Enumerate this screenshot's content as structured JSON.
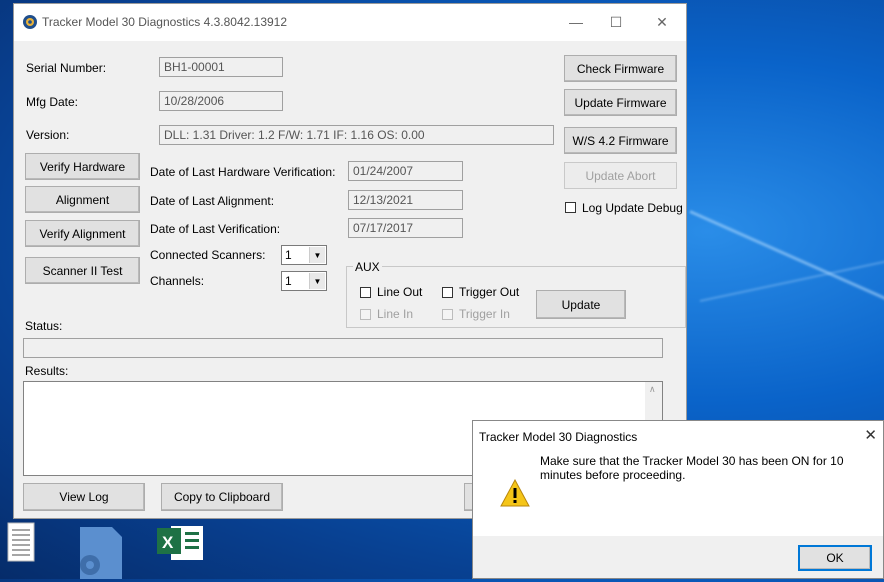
{
  "window": {
    "title": "Tracker Model 30 Diagnostics 4.3.8042.13912",
    "minimize": "—",
    "maximize": "☐",
    "close": "✕"
  },
  "info": {
    "serial_label": "Serial Number:",
    "serial_value": "BH1-00001",
    "mfg_label": "Mfg Date:",
    "mfg_value": "10/28/2006",
    "version_label": "Version:",
    "version_value": "DLL: 1.31  Driver: 1.2  F/W: 1.71 IF: 1.16  OS: 0.00"
  },
  "right_buttons": {
    "check_firmware": "Check Firmware",
    "update_firmware": "Update Firmware",
    "ws_firmware": "W/S 4.2 Firmware",
    "update_abort": "Update Abort",
    "log_update_debug": "Log Update Debug"
  },
  "left_buttons": {
    "verify_hardware": "Verify Hardware",
    "alignment": "Alignment",
    "verify_alignment": "Verify Alignment",
    "scanner_test": "Scanner II Test"
  },
  "dates": {
    "hw_label": "Date of Last Hardware Verification:",
    "hw_value": "01/24/2007",
    "align_label": "Date of Last Alignment:",
    "align_value": "12/13/2021",
    "verif_label": "Date of Last Verification:",
    "verif_value": "07/17/2017"
  },
  "scanners": {
    "connected_label": "Connected Scanners:",
    "connected_value": "1",
    "channels_label": "Channels:",
    "channels_value": "1"
  },
  "aux": {
    "title": "AUX",
    "line_out": "Line Out",
    "trigger_out": "Trigger Out",
    "line_in": "Line In",
    "trigger_in": "Trigger In",
    "update": "Update"
  },
  "status_label": "Status:",
  "results_label": "Results:",
  "bottom": {
    "view_log": "View Log",
    "copy_clipboard": "Copy to Clipboard"
  },
  "dialog": {
    "title": "Tracker Model 30 Diagnostics",
    "close": "✕",
    "message": "Make sure that the Tracker Model 30 has been ON for 10 minutes before proceeding.",
    "ok": "OK",
    "icon": "warning-icon"
  }
}
